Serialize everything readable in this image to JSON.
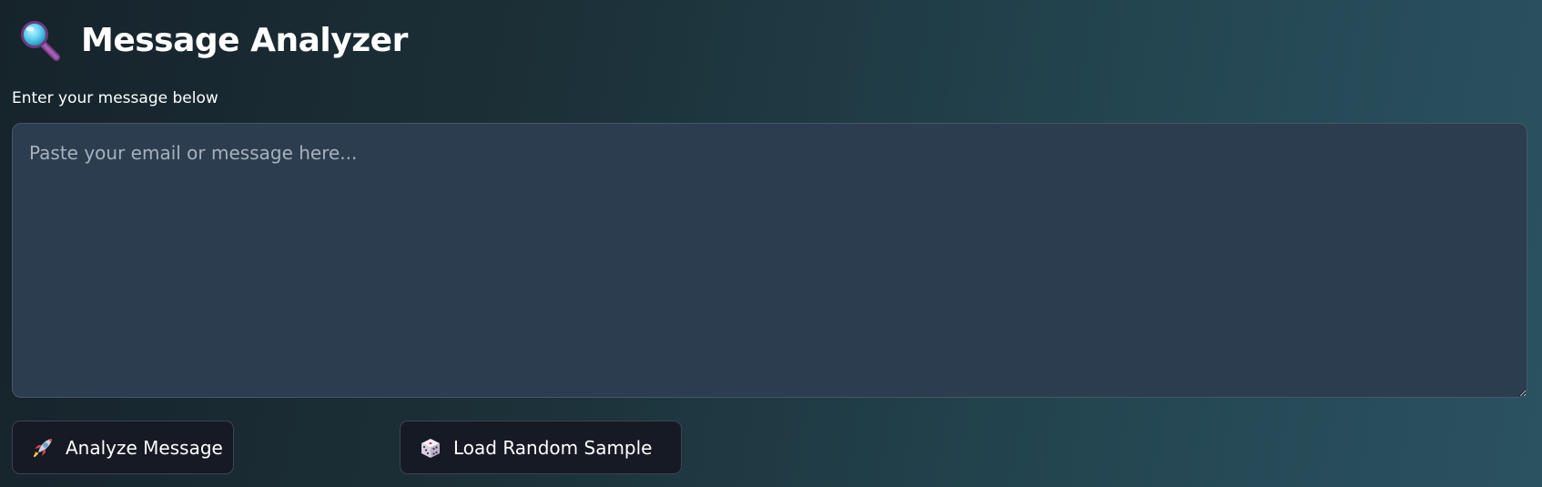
{
  "header": {
    "title": "Message Analyzer",
    "icon": "magnifying-glass-icon"
  },
  "form": {
    "label": "Enter your message below",
    "placeholder": "Paste your email or message here...",
    "value": ""
  },
  "actions": {
    "analyze": {
      "label": "Analyze Message",
      "icon": "rocket-icon"
    },
    "sample": {
      "label": "Load Random Sample",
      "icon": "dice-icon"
    }
  },
  "colors": {
    "background_start": "#16232b",
    "background_end": "#2b5261",
    "input_background": "#2c3d50",
    "button_background": "#151a24",
    "text": "#ffffff",
    "placeholder": "#a7b1bd"
  }
}
